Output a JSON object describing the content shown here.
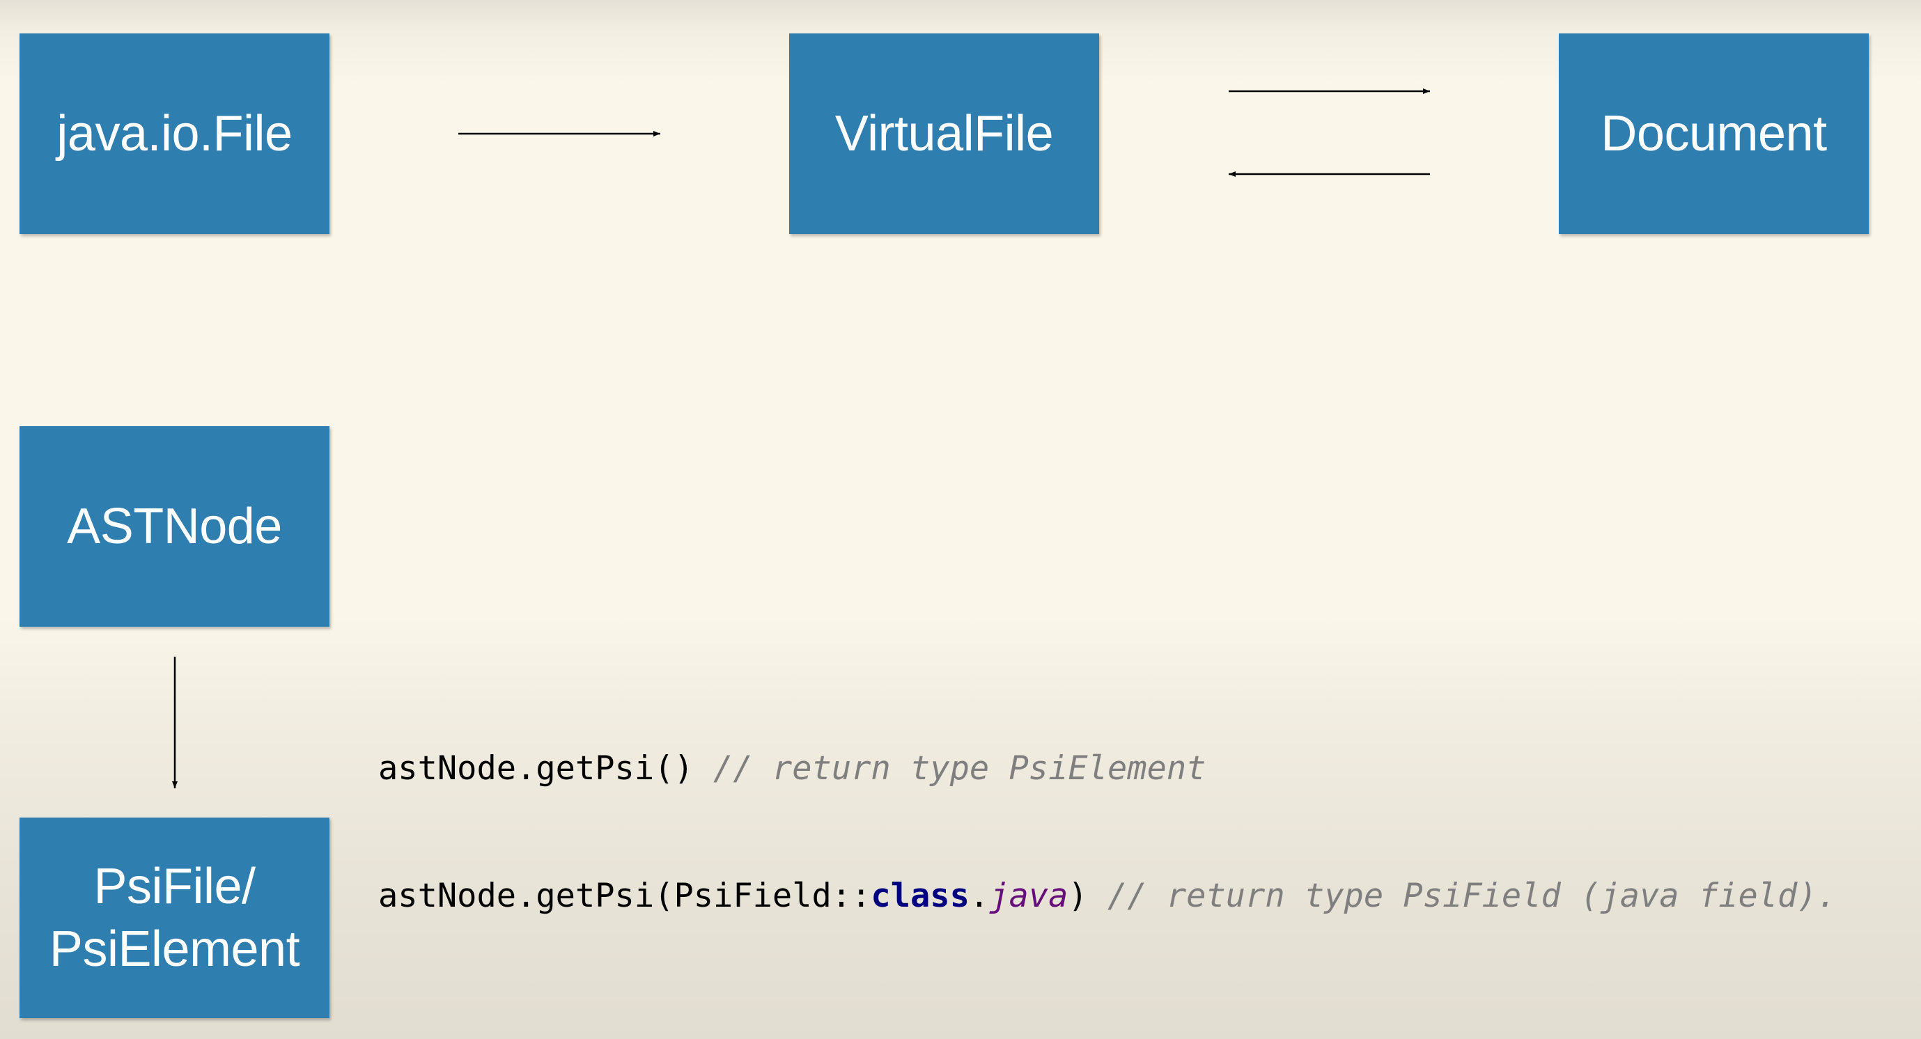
{
  "nodes": {
    "java_io_file": "java.io.File",
    "virtual_file": "VirtualFile",
    "document": "Document",
    "ast_node": "ASTNode",
    "psi_file_line1": "PsiFile/",
    "psi_file_line2": "PsiElement"
  },
  "code": {
    "line1": {
      "code": "astNode.getPsi()",
      "comment": " // return type PsiElement"
    },
    "line2": {
      "call_start": "astNode.getPsi(PsiField::",
      "keyword": "class",
      "dot": ".",
      "property": "java",
      "call_end": ")",
      "comment": " // return type PsiField (java field)."
    }
  },
  "colors": {
    "node_fill": "#2f7eb0",
    "node_text": "#ffffff",
    "background": "#faf6ea",
    "comment": "#7f7f7f",
    "keyword": "#000080",
    "property": "#660e7a"
  }
}
